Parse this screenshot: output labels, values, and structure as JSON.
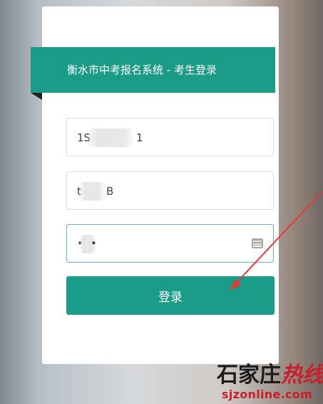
{
  "login": {
    "title": "衡水市中考报名系统 - 考生登录",
    "field1_value_start": "1S",
    "field1_value_end": "1",
    "field2_value_start": "t",
    "field2_value_end": "B",
    "password_mask_start": "•",
    "password_mask_end": "•",
    "submit_label": "登录"
  },
  "watermark": {
    "line1_dark": "石家庄",
    "line1_red": "热线",
    "line2": "sjzonline.com"
  },
  "colors": {
    "accent": "#1a9c89",
    "annotation_arrow": "#e53935",
    "focus_border": "#66afe9"
  },
  "icons": {
    "keyboard": "keyboard-icon"
  }
}
